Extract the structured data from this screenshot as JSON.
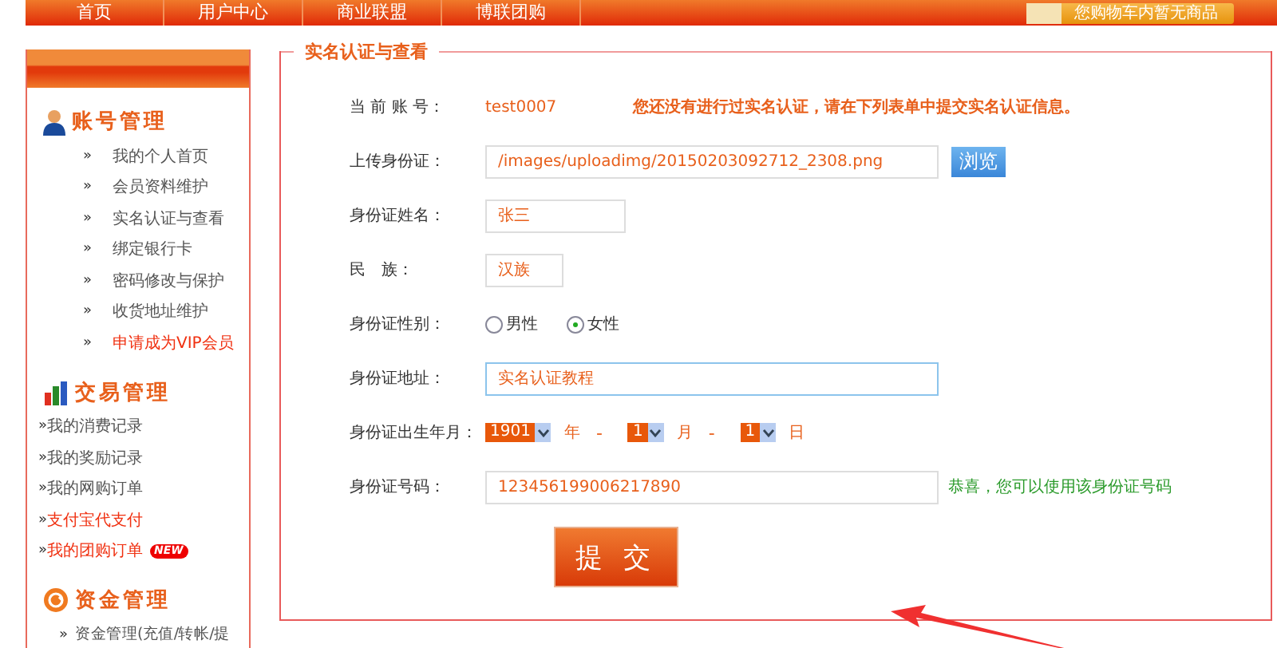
{
  "nav": {
    "items": [
      "首页",
      "用户中心",
      "商业联盟",
      "博联团购"
    ],
    "cart": "您购物车内暂无商品"
  },
  "sidebar": {
    "sections": [
      {
        "title": "账号管理",
        "bullet": "»",
        "items": [
          {
            "label": "我的个人首页",
            "highlighted": false
          },
          {
            "label": "会员资料维护",
            "highlighted": false
          },
          {
            "label": "实名认证与查看",
            "highlighted": false
          },
          {
            "label": "绑定银行卡",
            "highlighted": false
          },
          {
            "label": "密码修改与保护",
            "highlighted": false
          },
          {
            "label": "收货地址维护",
            "highlighted": false
          },
          {
            "label": "申请成为VIP会员",
            "highlighted": true
          }
        ]
      },
      {
        "title": "交易管理",
        "bullet": "»",
        "items": [
          {
            "label": "我的消费记录",
            "highlighted": false
          },
          {
            "label": "我的奖励记录",
            "highlighted": false
          },
          {
            "label": "我的网购订单",
            "highlighted": false
          },
          {
            "label": "支付宝代支付",
            "highlighted": true
          },
          {
            "label": "我的团购订单",
            "highlighted": true,
            "badge": "NEW"
          }
        ]
      },
      {
        "title": "资金管理",
        "bullet": "»",
        "items": [
          {
            "label": "资金管理(充值/转帐/提",
            "highlighted": false
          }
        ]
      }
    ]
  },
  "form": {
    "legend": "实名认证与查看",
    "rows": [
      {
        "kind": "text",
        "label": "当 前 账 号：",
        "value": "test0007",
        "note": "您还没有进行过实名认证，请在下列表单中提交实名认证信息。"
      },
      {
        "kind": "upload",
        "label": "上传身份证：",
        "value": "/images/uploadimg/20150203092712_2308.png",
        "button": "浏览"
      },
      {
        "kind": "input",
        "label": "身份证姓名：",
        "value": "张三"
      },
      {
        "kind": "input",
        "label": "民　族：",
        "value": "汉族"
      },
      {
        "kind": "radio",
        "label": "身份证性别：",
        "options": [
          {
            "label": "男性",
            "selected": false
          },
          {
            "label": "女性",
            "selected": true
          }
        ]
      },
      {
        "kind": "input",
        "label": "身份证地址：",
        "value": "实名认证教程",
        "focused": true
      },
      {
        "kind": "date",
        "label": "身份证出生年月：",
        "parts": [
          {
            "value": "1901",
            "unit": "年"
          },
          {
            "value": "1",
            "unit": "月"
          },
          {
            "value": "1",
            "unit": "日"
          }
        ],
        "separator": "-"
      },
      {
        "kind": "input",
        "label": "身份证号码：",
        "value": "123456199006217890",
        "hint": "恭喜，您可以使用该身份证号码"
      }
    ],
    "submit": "提 交"
  }
}
